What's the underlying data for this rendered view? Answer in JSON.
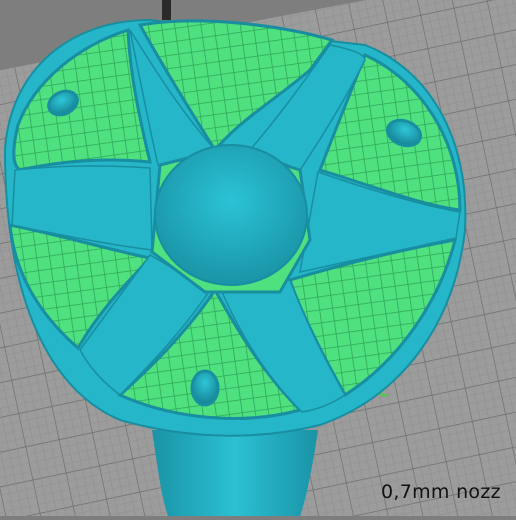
{
  "viewport": {
    "caption": "0,7mm nozz",
    "colors": {
      "background": "#7e7e7e",
      "bed": "#9c9c9c",
      "grid": "#6c6c6c",
      "model_wall": "#25b6c9",
      "model_wall_dark": "#188ea0",
      "infill": "#4fe07f",
      "infill_line": "#2fa65a",
      "x_axis": "#e23b3b",
      "y_axis": "#3fd23f",
      "nozzle": "#2a2a2a"
    }
  }
}
